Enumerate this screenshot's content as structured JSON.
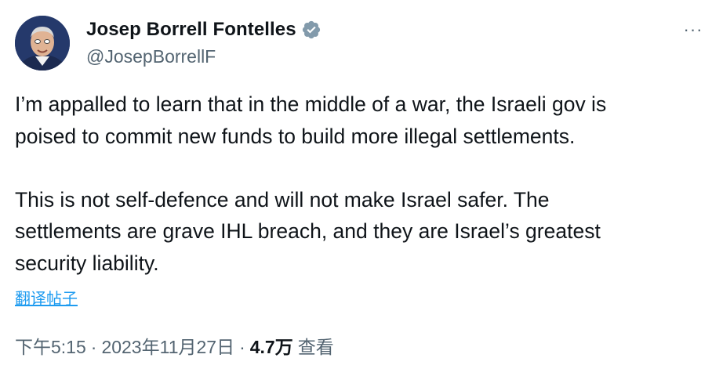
{
  "author": {
    "display_name": "Josep Borrell Fontelles",
    "handle": "@JosepBorrellF",
    "verified": true
  },
  "more_menu": {
    "label": "···"
  },
  "tweet": {
    "text": "I’m appalled to learn that in the middle of a war, the Israeli gov is\npoised to commit new funds to build more illegal settlements.\n\nThis is not self-defence and will not make Israel safer. The\nsettlements are grave IHL breach, and they are Israel’s greatest\nsecurity liability.",
    "translate_label": "翻译帖子"
  },
  "meta": {
    "time": "下午5:15",
    "separator": "·",
    "date": "2023年11月27日",
    "views_count": "4.7万",
    "views_label": "查看"
  },
  "colors": {
    "text": "#0f1419",
    "secondary": "#536471",
    "link": "#1d9bf0",
    "verified_badge": "#829aab"
  }
}
